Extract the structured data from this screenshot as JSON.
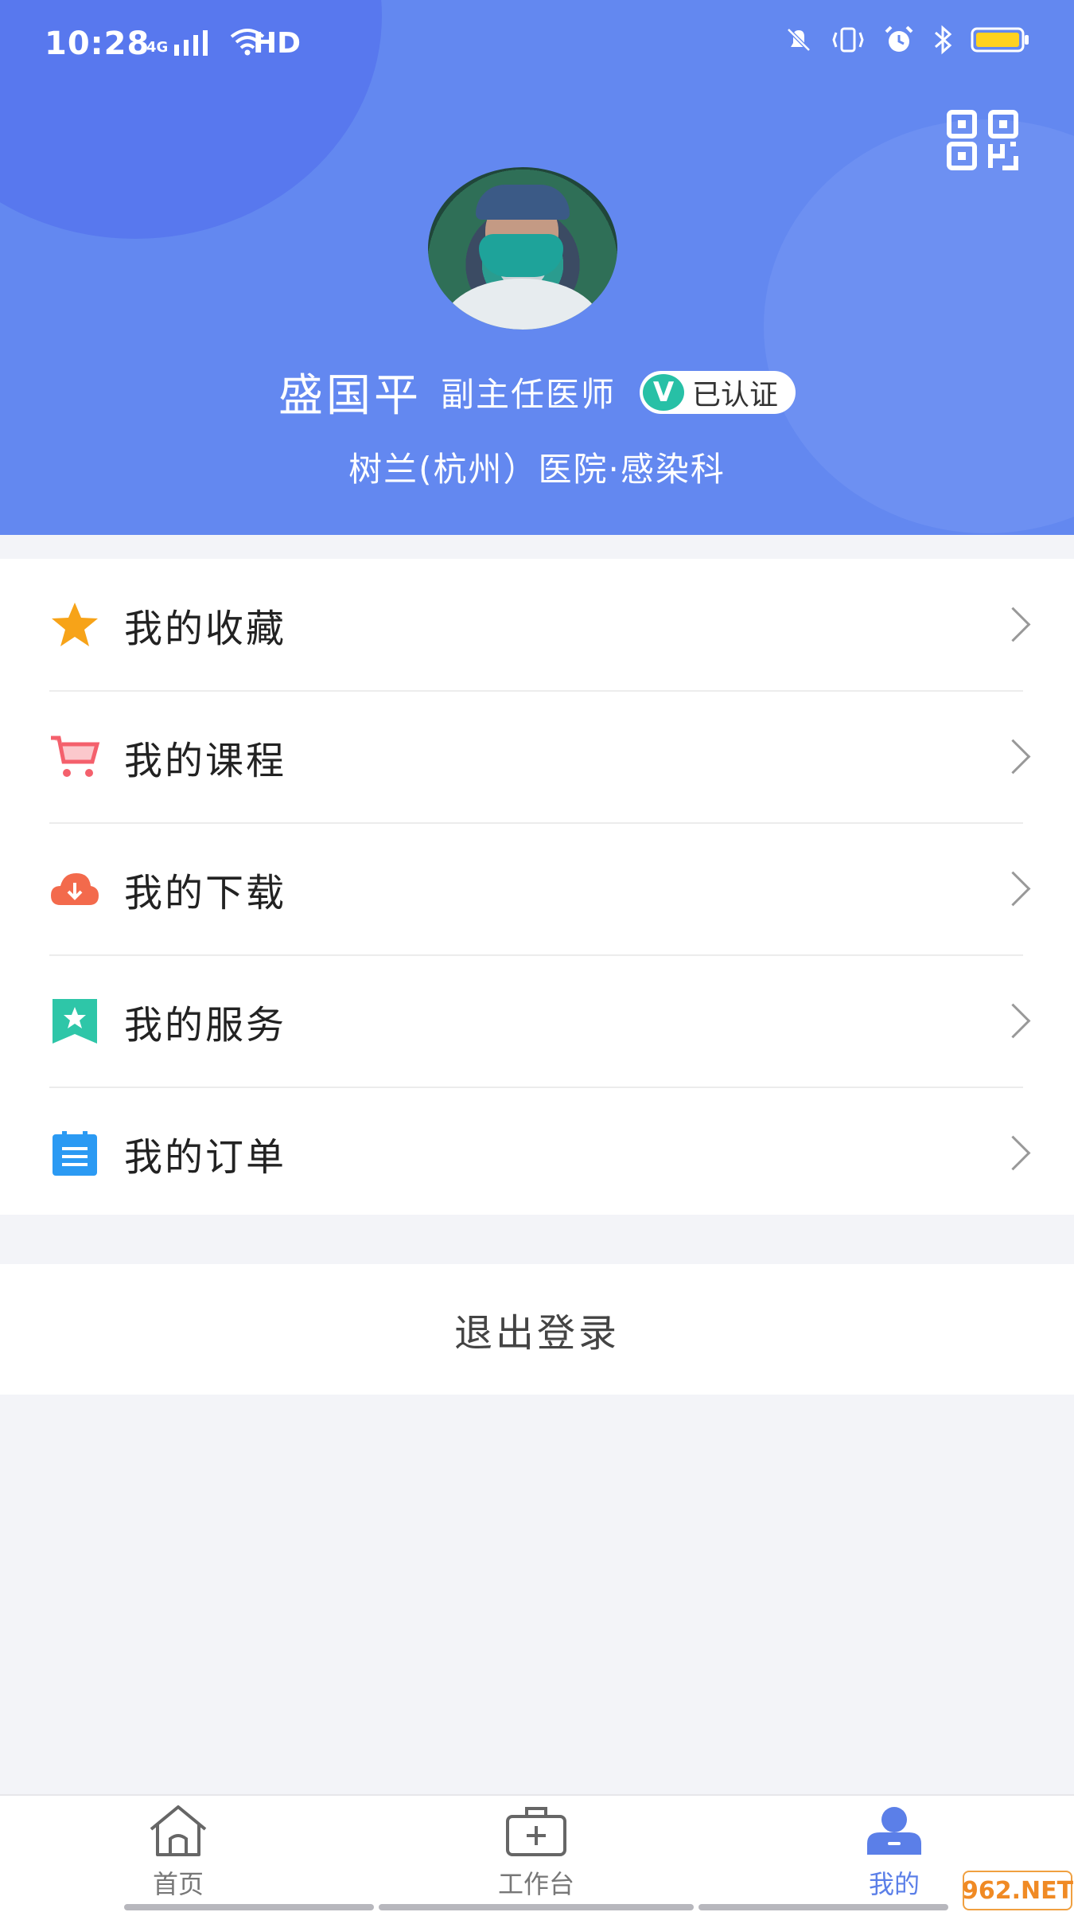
{
  "status_bar": {
    "time": "10:28",
    "network": "4G",
    "hd": "HD"
  },
  "profile": {
    "name": "盛国平",
    "title": "副主任医师",
    "verified_label": "已认证",
    "verified_mark": "V",
    "hospital": "树兰(杭州）医院·感染科"
  },
  "menu": {
    "items": [
      {
        "label": "我的收藏",
        "icon": "star-icon",
        "color": "#f7a318"
      },
      {
        "label": "我的课程",
        "icon": "cart-icon",
        "color": "#f4606c"
      },
      {
        "label": "我的下载",
        "icon": "cloud-download-icon",
        "color": "#f36a4c"
      },
      {
        "label": "我的服务",
        "icon": "bookmark-star-icon",
        "color": "#2ec6a8"
      },
      {
        "label": "我的订单",
        "icon": "clipboard-icon",
        "color": "#2b9af3"
      }
    ]
  },
  "logout_label": "退出登录",
  "tabbar": {
    "tabs": [
      {
        "label": "首页",
        "icon": "home-icon"
      },
      {
        "label": "工作台",
        "icon": "medical-kit-icon"
      },
      {
        "label": "我的",
        "icon": "user-icon",
        "active": true
      }
    ]
  },
  "watermark": "962.NET",
  "colors": {
    "header": "#6388f0",
    "accent": "#5b7fe8",
    "verified": "#27c0a6"
  }
}
